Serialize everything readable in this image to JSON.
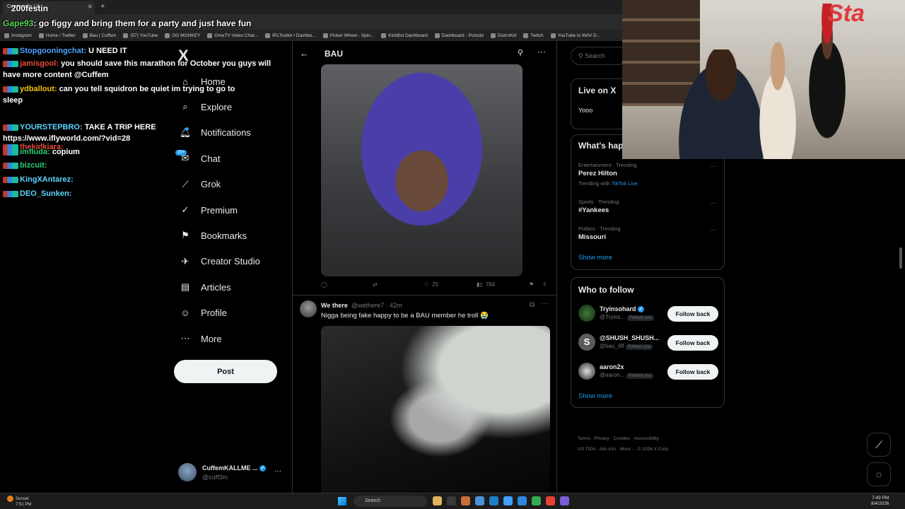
{
  "browser": {
    "active_tab": "Community / X",
    "bookmarks": [
      "Instagram",
      "Home / Twitter",
      "Bau | Cuffem",
      "(57) YouTube",
      "OG MONKEY",
      "OmeTV Video Chat...",
      "IRLToolkit • Dashbo...",
      "Picker Wheel - Spin...",
      "KickBot Dashboard",
      "Dashboard - Pulsoid",
      "DistroKid",
      "Twitch",
      "YouTube to WAV D..."
    ]
  },
  "stream_overlay": {
    "viewer_count": "200festin",
    "top_message": {
      "user": "Gape93",
      "text": "go figgy and bring them for a party and just have fun"
    },
    "chat": [
      {
        "user": "Stopgooningchat:",
        "text": "U NEED IT"
      },
      {
        "user": "jamisgool:",
        "text": "you should save this marathon for October you guys will"
      },
      {
        "user": "",
        "text": "have more content @Cuffem"
      },
      {
        "user": "ydballout:",
        "text": "can you tell squidron be quiet im trying to go to"
      },
      {
        "user": "",
        "text": "sleep"
      },
      {
        "user": "YOURSTEPBRO:",
        "text": "TAKE A TRIP HERE"
      },
      {
        "user": "",
        "text": "https://www.iflyworld.com/?vid=28"
      },
      {
        "user": "thekidkiara:",
        "text": ""
      },
      {
        "user": "imfluda:",
        "text": "copium"
      },
      {
        "user": "bizcuit:",
        "text": ""
      },
      {
        "user": "KingXAntarez:",
        "text": ""
      },
      {
        "user": "DEO_Sunken:",
        "text": ""
      }
    ]
  },
  "left_nav": {
    "logo": "X",
    "items": [
      "Home",
      "Explore",
      "Notifications",
      "Chat",
      "Grok",
      "Premium",
      "Bookmarks",
      "Creator Studio",
      "Articles",
      "Profile",
      "More"
    ],
    "chat_badge": "20+",
    "post_label": "Post",
    "account": {
      "name": "CuffemKALLME ...",
      "handle": "@cuff3m"
    }
  },
  "timeline": {
    "title": "BAU",
    "post1_actions": {
      "replies": "",
      "reposts": "",
      "likes": "25",
      "views": "784"
    },
    "post2": {
      "name": "We there",
      "handle": "@wethere7 · 42m",
      "text": "Nigga being fake happy to be a BAU member he troll 😭"
    }
  },
  "right_column": {
    "search_placeholder": "Search",
    "live": {
      "title": "Live on X",
      "text": "Yooo"
    },
    "happening": {
      "title": "What's happening",
      "trends": [
        {
          "meta": "Entertainment · Trending",
          "name": "Perez Hilton",
          "sub_prefix": "Trending with",
          "sub_link": "TikTok Live"
        },
        {
          "meta": "Sports · Trending",
          "name": "#Yankees",
          "sub_prefix": "",
          "sub_link": ""
        },
        {
          "meta": "Politics · Trending",
          "name": "Missouri",
          "sub_prefix": "",
          "sub_link": ""
        }
      ],
      "show_more": "Show more"
    },
    "who_to_follow": {
      "title": "Who to follow",
      "users": [
        {
          "name": "Tryinsohard",
          "handle": "@Tryins...",
          "tag": "Follows you",
          "button": "Follow back"
        },
        {
          "name": "@SHUSH_SHUSH...",
          "handle": "@bau_4lf",
          "tag": "Follows you",
          "button": "Follow back"
        },
        {
          "name": "aaron2x",
          "handle": "@aaron...",
          "tag": "Follows you",
          "button": "Follow back"
        }
      ],
      "show_more": "Show more"
    },
    "footer_line1": "Terms  ·  Privacy  ·  Cookies  ·  Accessibility  ·",
    "footer_line2": "US TIDA  ·  Ads info  ·  More ···  © 2026 X Corp."
  },
  "taskbar": {
    "weather_line1": "Sunset",
    "weather_line2": "7:51 PM",
    "search_placeholder": "Search",
    "time": "7:49 PM",
    "date": "8/4/2026"
  },
  "colors": {
    "accent": "#1d9bf0",
    "background": "#000000",
    "border": "#2f3336",
    "muted": "#71767b"
  }
}
